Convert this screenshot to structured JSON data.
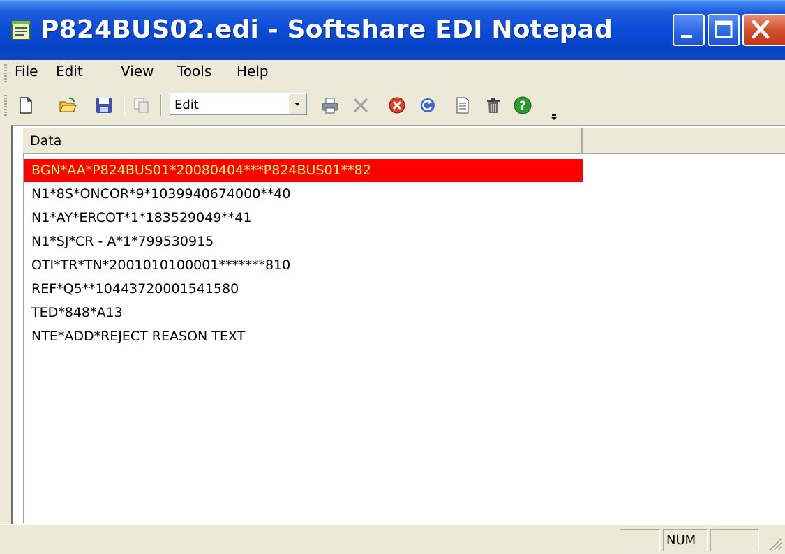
{
  "window": {
    "title": "P824BUS02.edi - Softshare EDI Notepad",
    "app_icon": "notepad-icon",
    "controls": [
      "minimize-icon",
      "maximize-icon",
      "close-icon"
    ]
  },
  "menu": {
    "items": [
      {
        "label": "File"
      },
      {
        "label": "Edit"
      },
      {
        "label": "View"
      },
      {
        "label": "Tools"
      },
      {
        "label": "Help"
      }
    ]
  },
  "toolbar": {
    "icons": [
      "new-document-icon",
      "open-folder-icon",
      "save-icon",
      "copy-icon",
      "print-icon",
      "delete-x-icon",
      "stop-icon",
      "refresh-icon",
      "properties-icon",
      "trash-icon",
      "help-icon"
    ],
    "mode_select": {
      "value": "Edit"
    }
  },
  "grid": {
    "column_header": "Data",
    "selected_index": 0,
    "rows": [
      "BGN*AA*P824BUS01*20080404***P824BUS01**82",
      "N1*8S*ONCOR*9*1039940674000**40",
      "N1*AY*ERCOT*1*183529049**41",
      "N1*SJ*CR - A*1*799530915",
      "OTI*TR*TN*2001010100001*******810",
      "REF*Q5**10443720001541580",
      "TED*848*A13",
      "NTE*ADD*REJECT REASON TEXT"
    ],
    "colors": {
      "selected_bg": "#FF0000",
      "selected_fg": "#FFFF66"
    }
  },
  "statusbar": {
    "panes": [
      "",
      "NUM",
      ""
    ]
  }
}
